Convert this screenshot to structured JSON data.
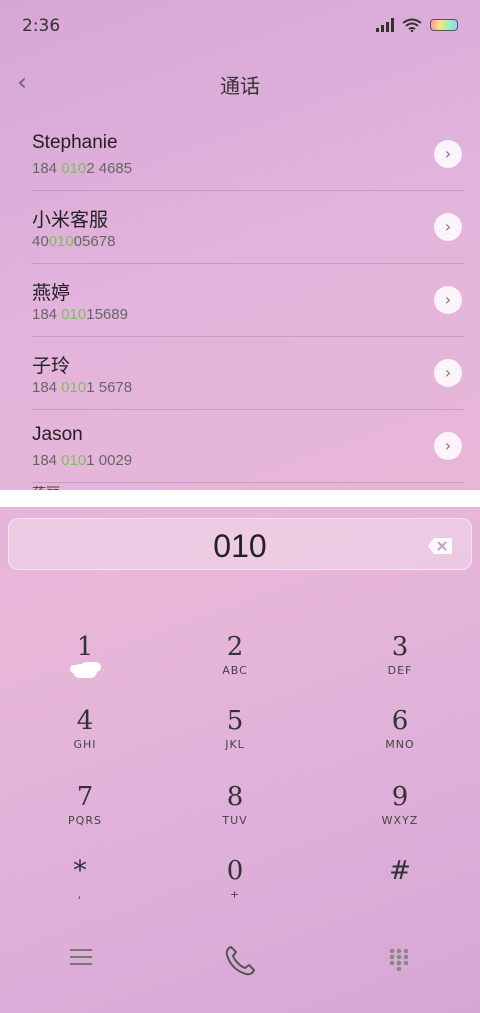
{
  "status": {
    "time": "2:36"
  },
  "header": {
    "title": "通话"
  },
  "contacts": [
    {
      "name": "Stephanie",
      "number_pre": "184 ",
      "number_hl": "010",
      "number_post": "2 4685"
    },
    {
      "name": "小米客服",
      "number_pre": "40",
      "number_hl": "010",
      "number_post": "05678"
    },
    {
      "name": "燕婷",
      "number_pre": "184 ",
      "number_hl": "010",
      "number_post": "15689"
    },
    {
      "name": "子玲",
      "number_pre": "184 ",
      "number_hl": "010",
      "number_post": "1 5678"
    },
    {
      "name": "Jason",
      "number_pre": "184 ",
      "number_hl": "010",
      "number_post": "1 0029"
    }
  ],
  "partial_contact": "蒋丽",
  "dialer": {
    "input_value": "010"
  },
  "keypad": [
    {
      "digit": "1",
      "letters": ""
    },
    {
      "digit": "2",
      "letters": "ABC"
    },
    {
      "digit": "3",
      "letters": "DEF"
    },
    {
      "digit": "4",
      "letters": "GHI"
    },
    {
      "digit": "5",
      "letters": "JKL"
    },
    {
      "digit": "6",
      "letters": "MNO"
    },
    {
      "digit": "7",
      "letters": "PQRS"
    },
    {
      "digit": "8",
      "letters": "TUV"
    },
    {
      "digit": "9",
      "letters": "WXYZ"
    },
    {
      "digit": "*",
      "letters": ","
    },
    {
      "digit": "0",
      "letters": "+"
    },
    {
      "digit": "#",
      "letters": ""
    }
  ],
  "icons": {
    "back": "chevron-left-icon",
    "detail": "chevron-right-icon",
    "backspace": "backspace-icon",
    "menu": "menu-icon",
    "call": "phone-icon",
    "keypad_toggle": "dialpad-icon"
  },
  "colors": {
    "highlight": "#7cc05a"
  }
}
